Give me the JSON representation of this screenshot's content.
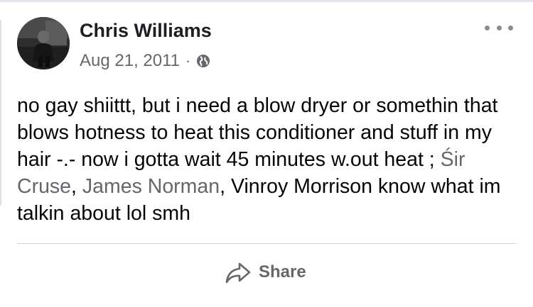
{
  "post": {
    "author": "Chris Williams",
    "date": "Aug 21, 2011",
    "separator": "·",
    "privacy_icon": "globe-icon",
    "more_icon": "more-horizontal-icon",
    "text_segments": [
      {
        "type": "text",
        "value": "no gay shiittt, but i need a blow dryer or somethin that blows hotness to heat this conditioner and stuff in my hair -.- now i gotta wait 45 minutes w.out heat ; "
      },
      {
        "type": "mention",
        "value": "Śir Cruse"
      },
      {
        "type": "text",
        "value": ", "
      },
      {
        "type": "mention",
        "value": "James Norman"
      },
      {
        "type": "text",
        "value": ", Vinroy Morrison know what im talkin about lol smh"
      }
    ]
  },
  "actions": {
    "share_label": "Share",
    "share_icon": "share-arrow-icon"
  },
  "colors": {
    "text": "#050505",
    "muted": "#65676b",
    "divider": "#ced0d4"
  }
}
